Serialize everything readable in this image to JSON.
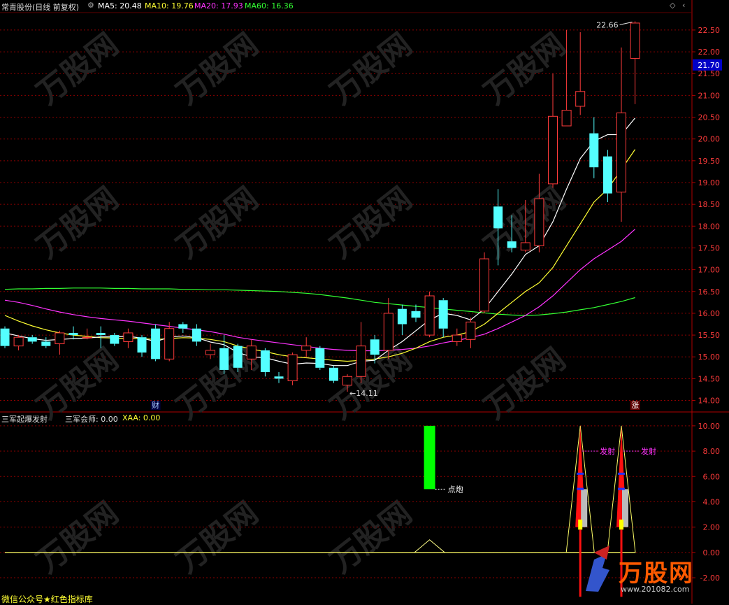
{
  "header": {
    "title": "常青股份(日线 前复权)",
    "ma5_label": "MA5: 20.48",
    "ma10_label": "MA10: 19.76",
    "ma20_label": "MA20: 17.93",
    "ma60_label": "MA60: 16.36"
  },
  "indicator_header": {
    "name": "三军起爆发射",
    "v1_label": "三军会师: 0.00",
    "v2_label": "XAA: 0.00"
  },
  "footer": {
    "text": "微信公众号★红色指标库"
  },
  "brand": {
    "logo": "万股网",
    "url": "www.201082.com"
  },
  "colors": {
    "up": "#ff3b3b",
    "down": "#54ffff",
    "grid": "#8b0000",
    "ma5": "#ffffff",
    "ma10": "#ffff33",
    "ma20": "#ff33ff",
    "ma60": "#33ff33",
    "axis_text": "#ff3b3b",
    "current_price_bg": "#0000c8"
  },
  "chart_data": [
    {
      "type": "candlestick",
      "ylim": [
        13.8,
        22.9
      ],
      "y_ticks": [
        "14.00",
        "14.50",
        "15.00",
        "15.50",
        "16.00",
        "16.50",
        "17.00",
        "17.50",
        "18.00",
        "18.50",
        "19.00",
        "19.50",
        "20.00",
        "20.50",
        "21.00",
        "21.50",
        "22.00",
        "22.50"
      ],
      "current_price": "21.70",
      "high_label": "22.66",
      "low_label": "14.11",
      "candles": [
        [
          15.65,
          15.25,
          15.7,
          15.2
        ],
        [
          15.25,
          15.45,
          15.5,
          15.15
        ],
        [
          15.45,
          15.35,
          15.5,
          15.3
        ],
        [
          15.35,
          15.25,
          15.45,
          15.2
        ],
        [
          15.3,
          15.55,
          15.6,
          15.05
        ],
        [
          15.55,
          15.5,
          15.7,
          15.4
        ],
        [
          15.45,
          15.45,
          15.65,
          15.4
        ],
        [
          15.55,
          15.5,
          15.7,
          15.2
        ],
        [
          15.5,
          15.3,
          15.55,
          15.25
        ],
        [
          15.35,
          15.55,
          15.65,
          15.2
        ],
        [
          15.45,
          15.1,
          15.5,
          15.0
        ],
        [
          15.65,
          14.95,
          15.75,
          14.9
        ],
        [
          14.95,
          15.65,
          15.8,
          14.9
        ],
        [
          15.75,
          15.65,
          15.8,
          15.55
        ],
        [
          15.65,
          15.35,
          15.75,
          15.25
        ],
        [
          15.05,
          15.15,
          15.3,
          14.95
        ],
        [
          15.2,
          14.7,
          15.5,
          14.6
        ],
        [
          15.25,
          14.75,
          15.3,
          14.65
        ],
        [
          14.95,
          15.25,
          15.4,
          14.7
        ],
        [
          15.15,
          14.65,
          15.2,
          14.55
        ],
        [
          14.55,
          14.5,
          14.65,
          14.4
        ],
        [
          14.45,
          15.05,
          15.1,
          14.35
        ],
        [
          15.15,
          15.25,
          15.45,
          15.0
        ],
        [
          15.2,
          14.75,
          15.25,
          14.7
        ],
        [
          14.75,
          14.45,
          14.8,
          14.4
        ],
        [
          14.35,
          14.55,
          14.6,
          14.2
        ],
        [
          14.55,
          15.25,
          15.8,
          14.4
        ],
        [
          15.4,
          15.05,
          15.5,
          14.85
        ],
        [
          15.15,
          16.0,
          16.35,
          14.95
        ],
        [
          16.1,
          15.75,
          16.2,
          15.5
        ],
        [
          16.05,
          15.9,
          16.2,
          15.8
        ],
        [
          15.5,
          16.4,
          16.5,
          15.45
        ],
        [
          16.3,
          15.65,
          16.35,
          15.45
        ],
        [
          15.35,
          15.5,
          15.65,
          15.25
        ],
        [
          15.4,
          15.8,
          15.9,
          15.2
        ],
        [
          16.05,
          17.25,
          17.4,
          16.0
        ],
        [
          18.45,
          17.95,
          18.85,
          17.1
        ],
        [
          17.65,
          17.5,
          18.25,
          17.4
        ],
        [
          17.45,
          17.62,
          18.6,
          17.4
        ],
        [
          17.55,
          18.63,
          19.2,
          17.4
        ],
        [
          18.97,
          20.52,
          21.5,
          18.88
        ],
        [
          20.3,
          20.66,
          22.5,
          20.3
        ],
        [
          20.75,
          21.09,
          22.45,
          20.55
        ],
        [
          20.13,
          19.35,
          20.5,
          19.1
        ],
        [
          19.6,
          18.75,
          19.75,
          18.55
        ],
        [
          18.78,
          20.6,
          22.1,
          18.1
        ],
        [
          21.85,
          22.66,
          22.7,
          20.8
        ]
      ],
      "ma5": [
        15.55,
        15.48,
        15.42,
        15.38,
        15.4,
        15.42,
        15.43,
        15.46,
        15.46,
        15.47,
        15.43,
        15.35,
        15.45,
        15.48,
        15.44,
        15.34,
        15.28,
        15.1,
        15.0,
        14.98,
        14.9,
        14.83,
        14.86,
        14.85,
        14.8,
        14.8,
        14.9,
        14.92,
        15.15,
        15.35,
        15.6,
        15.85,
        16.0,
        15.95,
        15.85,
        16.1,
        16.5,
        16.9,
        17.35,
        17.55,
        18.1,
        18.85,
        19.55,
        19.95,
        20.1,
        20.1,
        20.48
      ],
      "ma10": [
        15.95,
        15.82,
        15.71,
        15.62,
        15.55,
        15.5,
        15.47,
        15.44,
        15.43,
        15.42,
        15.42,
        15.4,
        15.42,
        15.44,
        15.43,
        15.4,
        15.35,
        15.25,
        15.18,
        15.12,
        15.05,
        15.0,
        14.98,
        14.95,
        14.92,
        14.9,
        14.92,
        14.95,
        15.0,
        15.08,
        15.2,
        15.35,
        15.45,
        15.5,
        15.58,
        15.75,
        16.0,
        16.25,
        16.5,
        16.7,
        17.05,
        17.55,
        18.05,
        18.55,
        18.85,
        19.3,
        19.76
      ],
      "ma20": [
        16.3,
        16.25,
        16.18,
        16.1,
        16.03,
        15.97,
        15.92,
        15.88,
        15.85,
        15.82,
        15.78,
        15.74,
        15.7,
        15.66,
        15.62,
        15.58,
        15.52,
        15.45,
        15.4,
        15.36,
        15.32,
        15.28,
        15.24,
        15.2,
        15.17,
        15.15,
        15.14,
        15.14,
        15.15,
        15.17,
        15.2,
        15.25,
        15.32,
        15.38,
        15.44,
        15.52,
        15.65,
        15.8,
        15.95,
        16.15,
        16.4,
        16.7,
        17.0,
        17.25,
        17.45,
        17.65,
        17.93
      ],
      "ma60": [
        16.55,
        16.56,
        16.56,
        16.57,
        16.57,
        16.58,
        16.58,
        16.58,
        16.57,
        16.57,
        16.56,
        16.56,
        16.56,
        16.55,
        16.55,
        16.54,
        16.54,
        16.53,
        16.52,
        16.51,
        16.5,
        16.48,
        16.46,
        16.43,
        16.39,
        16.35,
        16.3,
        16.25,
        16.22,
        16.19,
        16.16,
        16.13,
        16.1,
        16.07,
        16.04,
        16.01,
        15.98,
        15.96,
        15.95,
        15.96,
        15.99,
        16.03,
        16.08,
        16.13,
        16.2,
        16.27,
        16.36
      ],
      "markers": [
        {
          "label": "财",
          "index": 11
        },
        {
          "label": "涨",
          "index": 46
        }
      ]
    },
    {
      "type": "indicator",
      "ylim": [
        -3.6,
        10.6
      ],
      "y_ticks": [
        "10.00",
        "8.00",
        "6.00",
        "4.00",
        "2.00",
        "0.00",
        "-2.00"
      ],
      "green_bar": {
        "index": 31,
        "from": 5.0,
        "to": 10.0,
        "label": "点炮"
      },
      "triangle_small": {
        "index": 31,
        "peak": 1.0
      },
      "rockets": [
        {
          "index": 42,
          "label": "发射"
        },
        {
          "index": 45,
          "label": "发射"
        }
      ]
    }
  ]
}
